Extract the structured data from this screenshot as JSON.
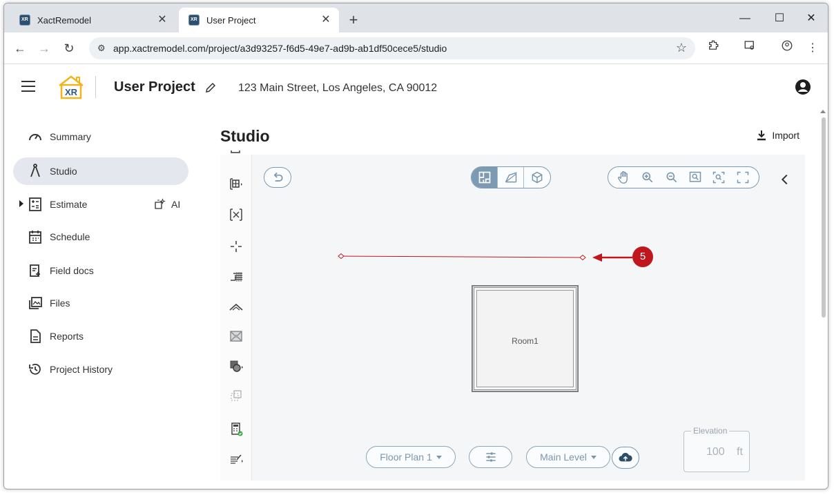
{
  "browser": {
    "tabs": [
      {
        "label": "XactRemodel"
      },
      {
        "label": "User Project"
      }
    ],
    "url": "app.xactremodel.com/project/a3d93257-f6d5-49e7-ad9b-ab1df50cece5/studio"
  },
  "header": {
    "logo_text": "XR",
    "project_title": "User Project",
    "address": "123 Main Street, Los Angeles, CA 90012"
  },
  "sidebar": {
    "items": [
      {
        "label": "Summary",
        "icon": "speedometer-icon"
      },
      {
        "label": "Studio",
        "icon": "compass-icon",
        "selected": true
      },
      {
        "label": "Estimate",
        "icon": "calculator-icon",
        "expandable": true
      },
      {
        "label": "Schedule",
        "icon": "calendar-icon"
      },
      {
        "label": "Field docs",
        "icon": "field-docs-icon"
      },
      {
        "label": "Files",
        "icon": "files-icon"
      },
      {
        "label": "Reports",
        "icon": "report-icon"
      },
      {
        "label": "Project History",
        "icon": "history-icon"
      }
    ],
    "ai_label": "AI"
  },
  "main": {
    "title": "Studio",
    "import_label": "Import"
  },
  "canvas": {
    "room_label": "Room1",
    "callout_number": "5"
  },
  "bottom_bar": {
    "floor_plan_label": "Floor Plan 1",
    "level_label": "Main Level",
    "elevation_label": "Elevation",
    "elevation_value": "100",
    "elevation_unit": "ft"
  },
  "colors": {
    "accent": "#7c9ab3",
    "marker": "#c0161d",
    "selected_nav": "#e4e7ee"
  }
}
